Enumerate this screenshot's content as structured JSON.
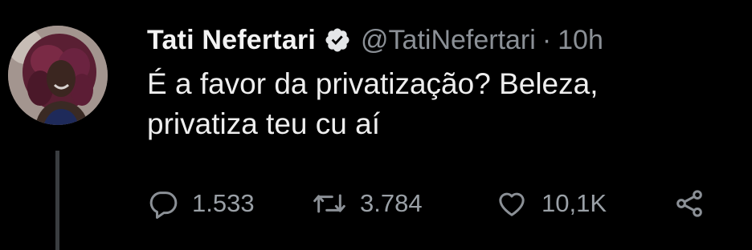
{
  "tweet": {
    "author_name": "Tati Nefertari",
    "handle": "@TatiNefertari",
    "separator": "·",
    "time": "10h",
    "verified": true,
    "text_lines": [
      "É a favor da privatização? Beleza,",
      "privatiza teu cu aí"
    ],
    "replies": "1.533",
    "retweets": "3.784",
    "likes": "10,1K"
  },
  "icons": {
    "avatar": "avatar",
    "verified": "verified-badge-icon",
    "reply": "reply-icon",
    "retweet": "retweet-icon",
    "like": "heart-icon",
    "share": "share-icon"
  },
  "colors": {
    "background": "#000000",
    "text_primary": "#eeeeee",
    "text_secondary": "#8b9096",
    "thread_line": "#3a3d40"
  }
}
